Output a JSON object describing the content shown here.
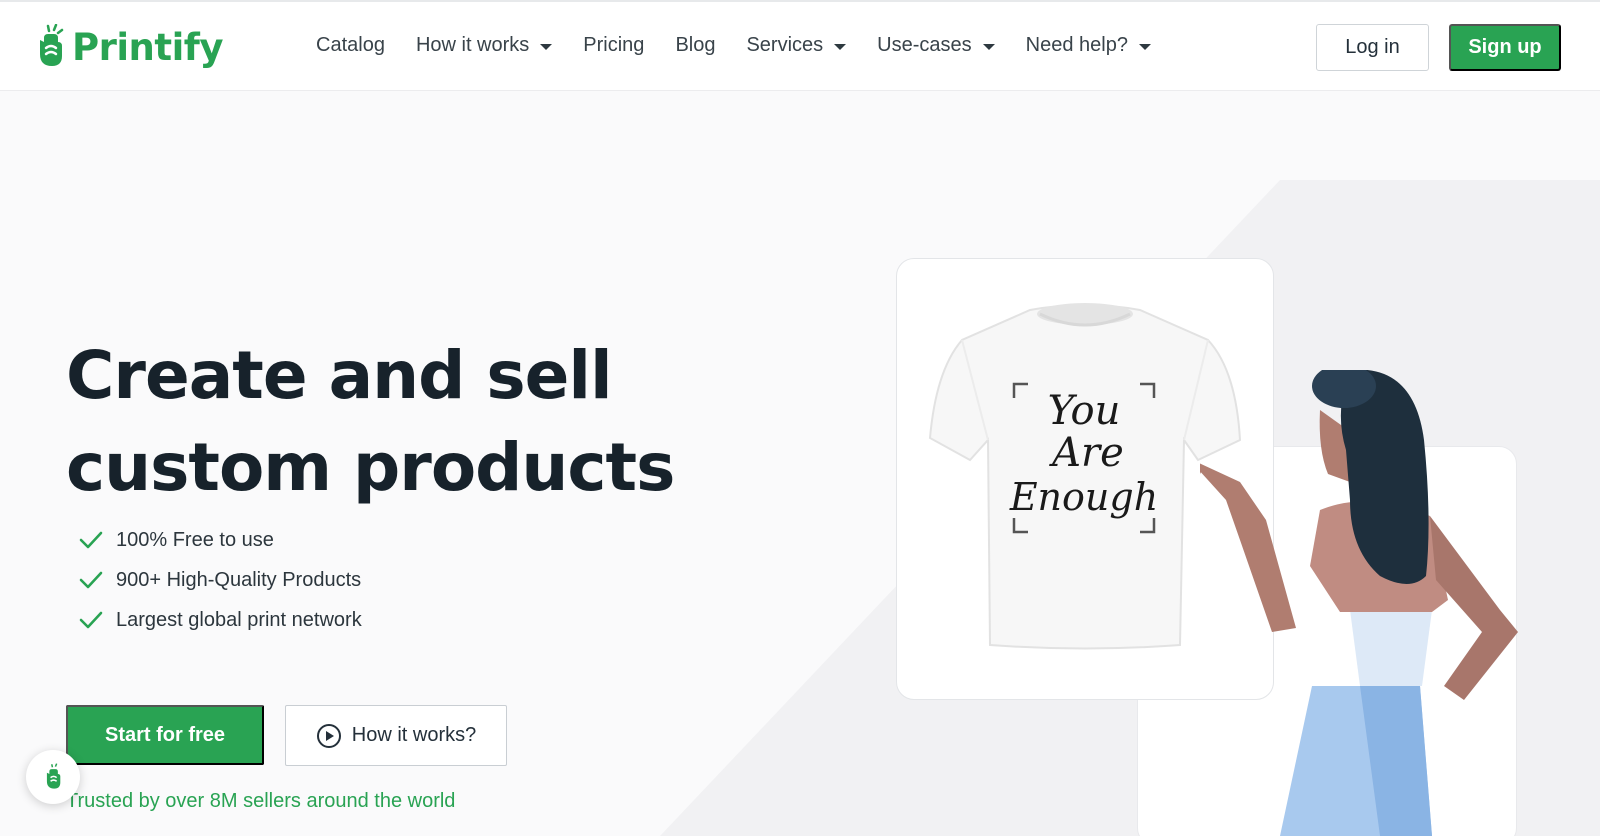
{
  "brand": {
    "name": "Printify",
    "logo_icon": "hand-logo-icon",
    "accent_color": "#29a353"
  },
  "nav": {
    "items": [
      {
        "label": "Catalog",
        "has_dropdown": false
      },
      {
        "label": "How it works",
        "has_dropdown": true
      },
      {
        "label": "Pricing",
        "has_dropdown": false
      },
      {
        "label": "Blog",
        "has_dropdown": false
      },
      {
        "label": "Services",
        "has_dropdown": true
      },
      {
        "label": "Use-cases",
        "has_dropdown": true
      },
      {
        "label": "Need help?",
        "has_dropdown": true
      }
    ]
  },
  "auth": {
    "login_label": "Log in",
    "signup_label": "Sign up"
  },
  "hero": {
    "headline_line1": "Create and sell",
    "headline_line2": "custom products",
    "features": [
      "100% Free to use",
      "900+ High-Quality Products",
      "Largest global print network"
    ],
    "cta_primary": "Start for free",
    "cta_secondary": "How it works?",
    "trusted_text": "Trusted by over 8M sellers around the world"
  },
  "illustration": {
    "tshirt_print_lines": [
      "You",
      "Are",
      "Enough"
    ]
  }
}
